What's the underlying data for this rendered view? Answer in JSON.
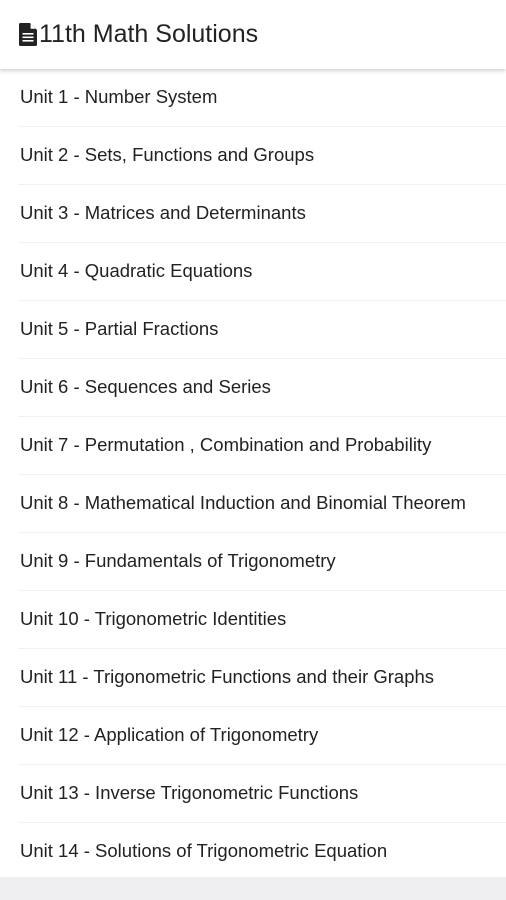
{
  "header": {
    "icon": "document-icon",
    "title": "11th Math Solutions"
  },
  "units": [
    {
      "label": "Unit 1 - Number System"
    },
    {
      "label": "Unit 2 - Sets, Functions and Groups"
    },
    {
      "label": "Unit 3 - Matrices and Determinants"
    },
    {
      "label": "Unit 4 - Quadratic Equations"
    },
    {
      "label": "Unit 5 - Partial Fractions"
    },
    {
      "label": "Unit 6 - Sequences and Series"
    },
    {
      "label": "Unit 7 - Permutation , Combination and Probability"
    },
    {
      "label": "Unit 8 - Mathematical Induction and Binomial Theorem"
    },
    {
      "label": "Unit 9 - Fundamentals of Trigonometry"
    },
    {
      "label": "Unit 10 - Trigonometric Identities"
    },
    {
      "label": "Unit 11 - Trigonometric Functions and their Graphs"
    },
    {
      "label": "Unit 12 - Application of Trigonometry"
    },
    {
      "label": "Unit 13 - Inverse Trigonometric Functions"
    },
    {
      "label": "Unit 14 - Solutions of Trigonometric Equation"
    }
  ]
}
